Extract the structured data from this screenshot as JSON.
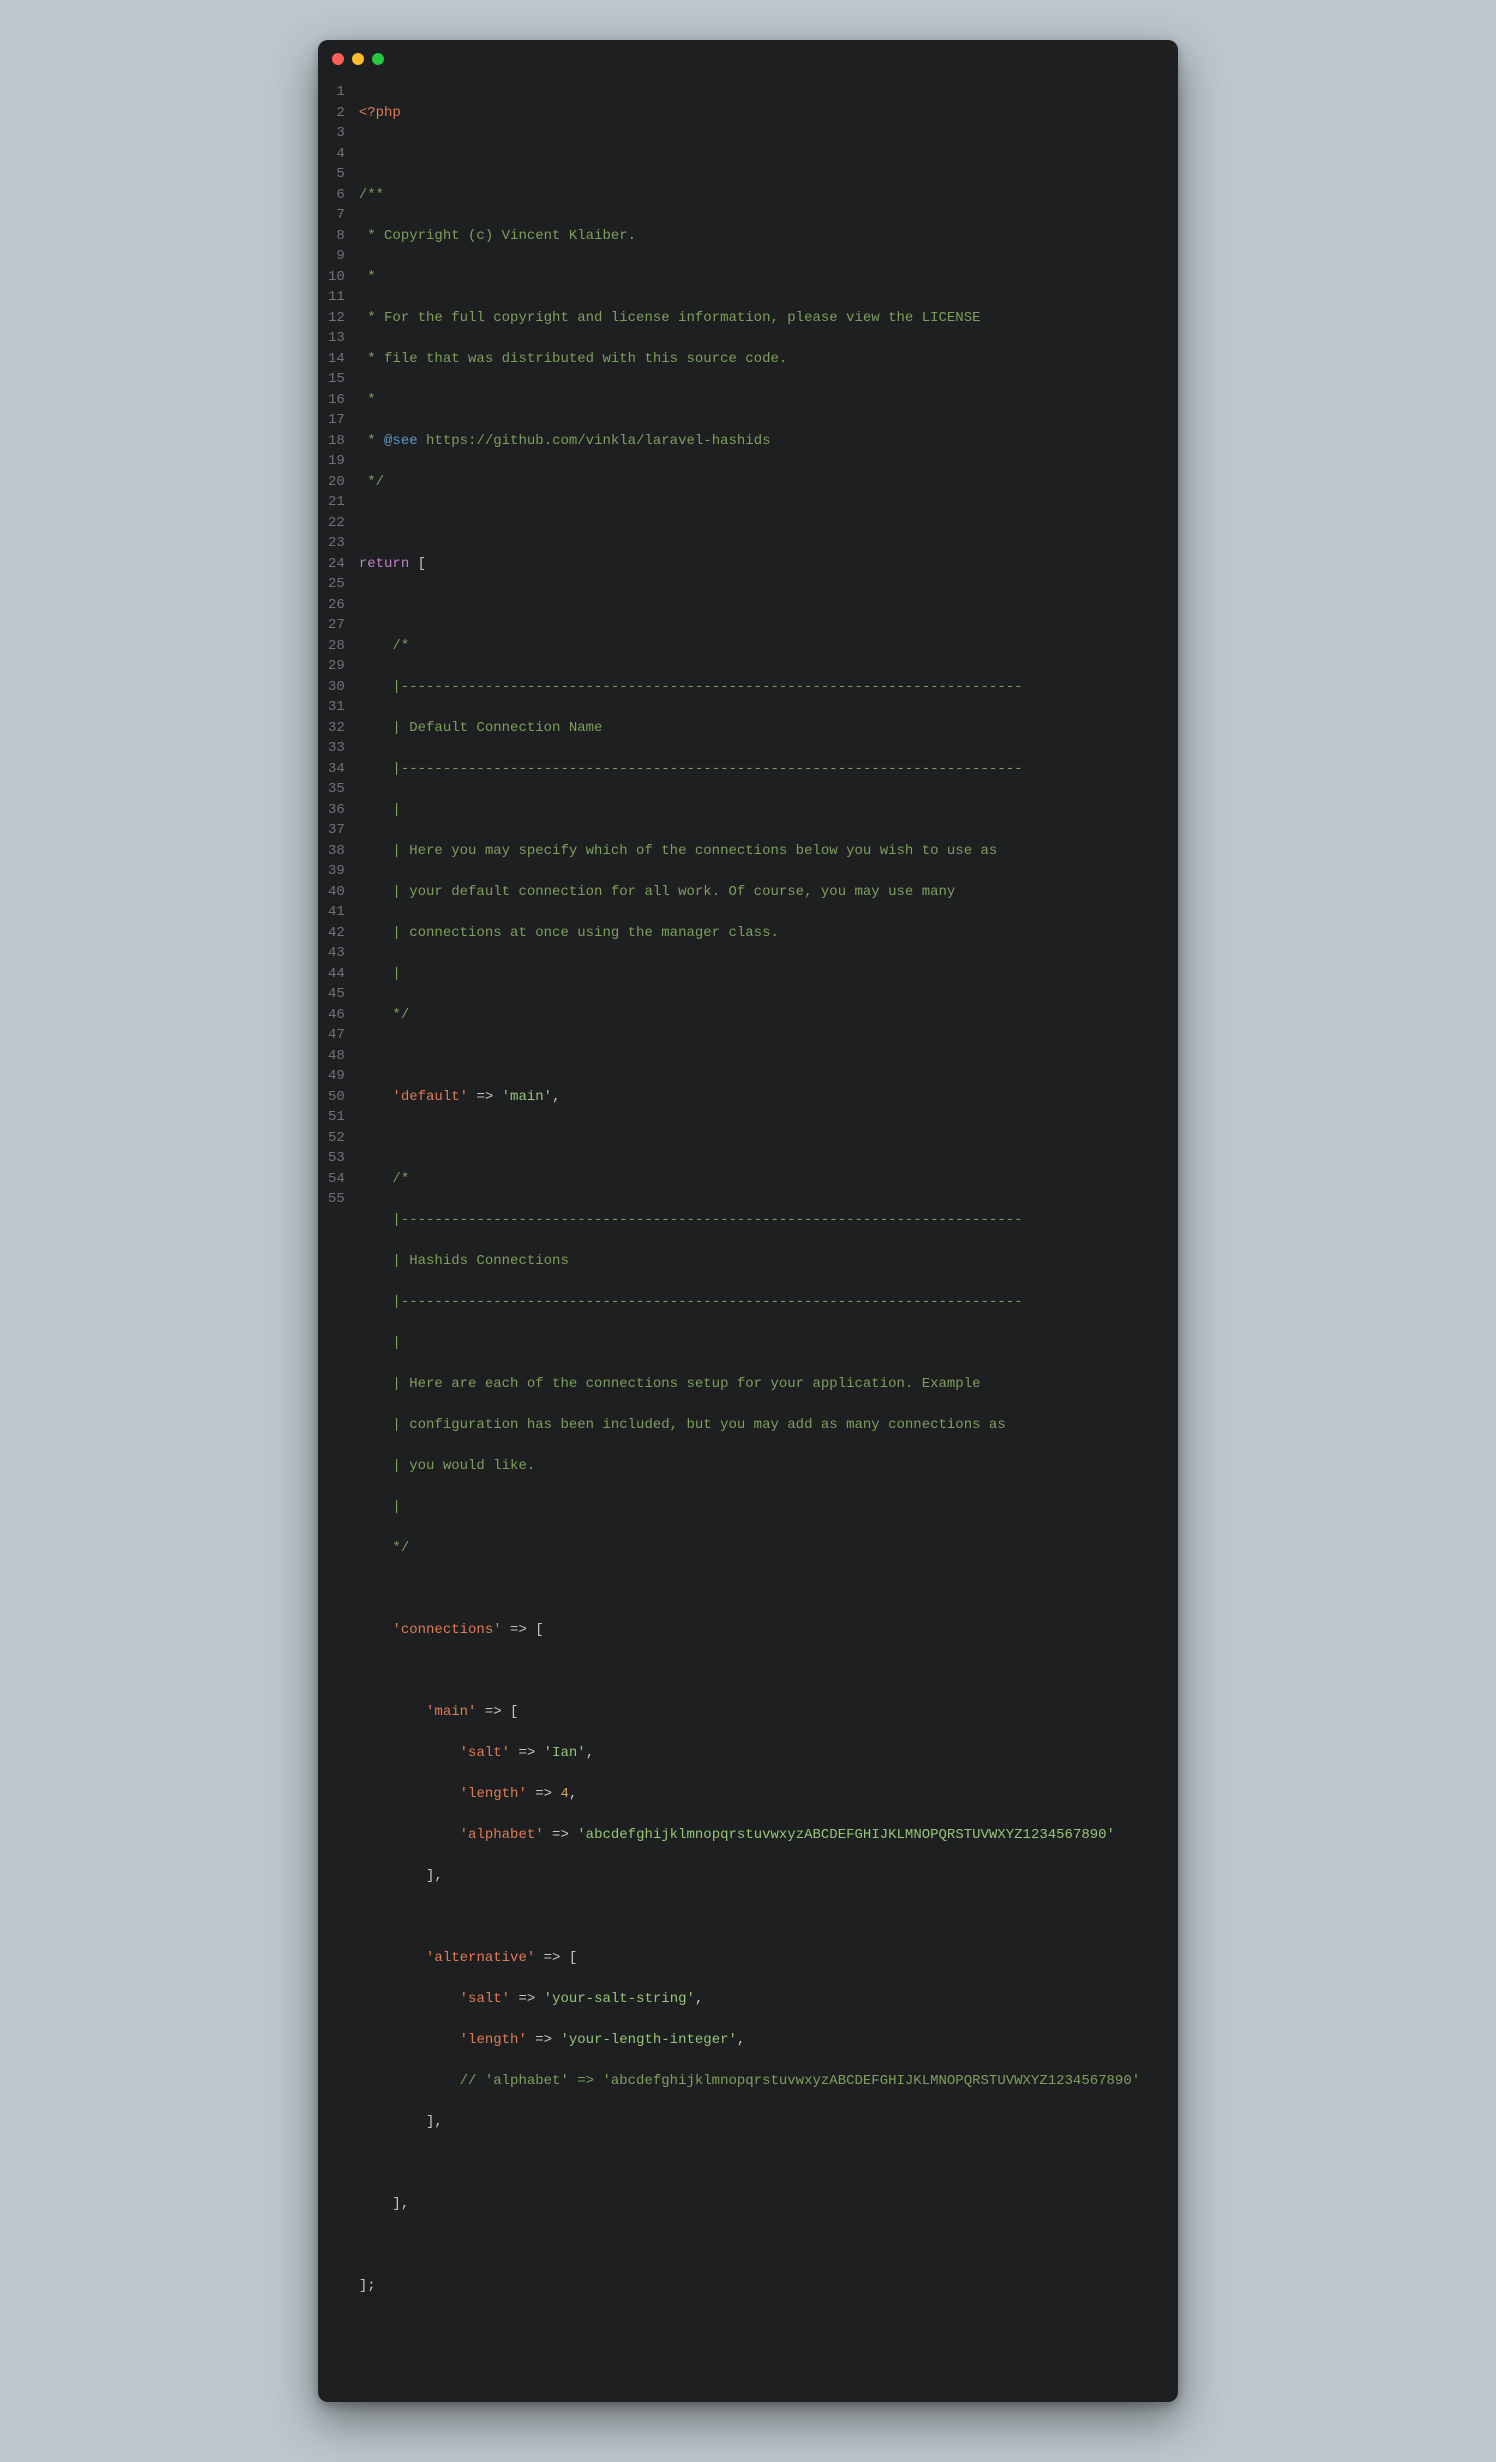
{
  "window": {
    "traffic_light_close": "close",
    "traffic_light_min": "minimize",
    "traffic_light_max": "zoom"
  },
  "colors": {
    "background_page": "#bcc6cc",
    "background_editor": "#1e1f21",
    "gutter_text": "#6f7277",
    "default_text": "#c6c6c7",
    "tag": "#e07b53",
    "comment": "#7d9f5b",
    "doctag": "#5f97c7",
    "keyword": "#c181c5",
    "string": "#97c475",
    "number": "#d5a35d"
  },
  "file": {
    "language": "php",
    "php_open_tag": "<?php",
    "header_block": {
      "open": "/**",
      "l1": " * Copyright (c) Vincent Klaiber.",
      "l2": " *",
      "l3": " * For the full copyright and license information, please view the LICENSE",
      "l4": " * file that was distributed with this source code.",
      "l5": " *",
      "l6_pre": " * ",
      "l6_tag": "@see",
      "l6_url": " https://github.com/vinkla/laravel-hashids",
      "close": " */"
    },
    "return_kw": "return",
    "open_bracket": " [",
    "close_bracket": "];",
    "section1": {
      "c_open": "    /*",
      "rule1": "    |--------------------------------------------------------------------------",
      "title": "    | Default Connection Name",
      "rule2": "    |--------------------------------------------------------------------------",
      "blank1": "    |",
      "p1": "    | Here you may specify which of the connections below you wish to use as",
      "p2": "    | your default connection for all work. Of course, you may use many",
      "p3": "    | connections at once using the manager class.",
      "blank2": "    |",
      "c_close": "    */"
    },
    "default_line": {
      "indent": "    ",
      "key": "'default'",
      "arrow": " => ",
      "value": "'main'",
      "end": ","
    },
    "section2": {
      "c_open": "    /*",
      "rule1": "    |--------------------------------------------------------------------------",
      "title": "    | Hashids Connections",
      "rule2": "    |--------------------------------------------------------------------------",
      "blank1": "    |",
      "p1": "    | Here are each of the connections setup for your application. Example",
      "p2": "    | configuration has been included, but you may add as many connections as",
      "p3": "    | you would like.",
      "blank2": "    |",
      "c_close": "    */"
    },
    "connections_line": {
      "indent": "    ",
      "key": "'connections'",
      "arrow": " => [",
      "close": "    ],"
    },
    "main_conn": {
      "open_indent": "        ",
      "open_key": "'main'",
      "open_arrow": " => [",
      "salt_indent": "            ",
      "salt_key": "'salt'",
      "salt_arrow": " => ",
      "salt_val": "'Ian'",
      "salt_end": ",",
      "len_key": "'length'",
      "len_arrow": " => ",
      "len_val": "4",
      "len_end": ",",
      "alpha_key": "'alphabet'",
      "alpha_arrow": " => ",
      "alpha_val": "'abcdefghijklmnopqrstuvwxyzABCDEFGHIJKLMNOPQRSTUVWXYZ1234567890'",
      "close": "        ],"
    },
    "alt_conn": {
      "open_key": "'alternative'",
      "open_arrow": " => [",
      "salt_key": "'salt'",
      "salt_arrow": " => ",
      "salt_val": "'your-salt-string'",
      "salt_end": ",",
      "len_key": "'length'",
      "len_arrow": " => ",
      "len_val": "'your-length-integer'",
      "len_end": ",",
      "alpha_comment": "            // 'alphabet' => 'abcdefghijklmnopqrstuvwxyzABCDEFGHIJKLMNOPQRSTUVWXYZ1234567890'",
      "close": "        ],"
    },
    "line_count": 55
  }
}
